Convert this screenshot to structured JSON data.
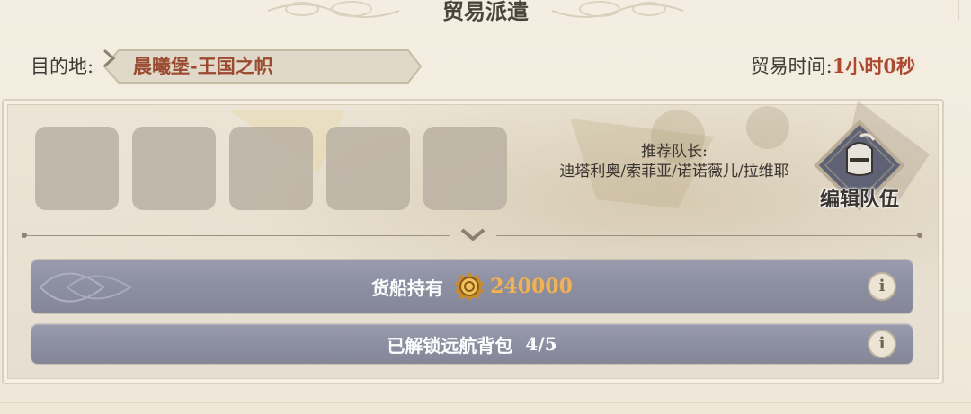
{
  "header": {
    "title": "贸易派遣"
  },
  "destination": {
    "label": "目的地:",
    "value": "晨曦堡-王国之帜"
  },
  "trade_time": {
    "label": "贸易时间:",
    "value": "1小时0秒"
  },
  "team": {
    "slots": [
      {},
      {},
      {},
      {},
      {}
    ],
    "recommend_title": "推荐队长:",
    "recommend_names": "迪塔利奥/索菲亚/诺诺薇儿/拉维耶",
    "edit_label": "编辑队伍",
    "edit_icon": "knight-helmet-icon"
  },
  "cargo": {
    "label": "货船持有",
    "amount": "240000",
    "coin_icon": "gold-coin-icon"
  },
  "backpack": {
    "label": "已解锁远航背包",
    "progress": "4/5"
  },
  "info_glyph": "i",
  "colors": {
    "destination_text": "#9a4a2e",
    "time_text": "#b0472e",
    "amount_text": "#f5b24a",
    "bar_bg": "#8c8ea1"
  }
}
